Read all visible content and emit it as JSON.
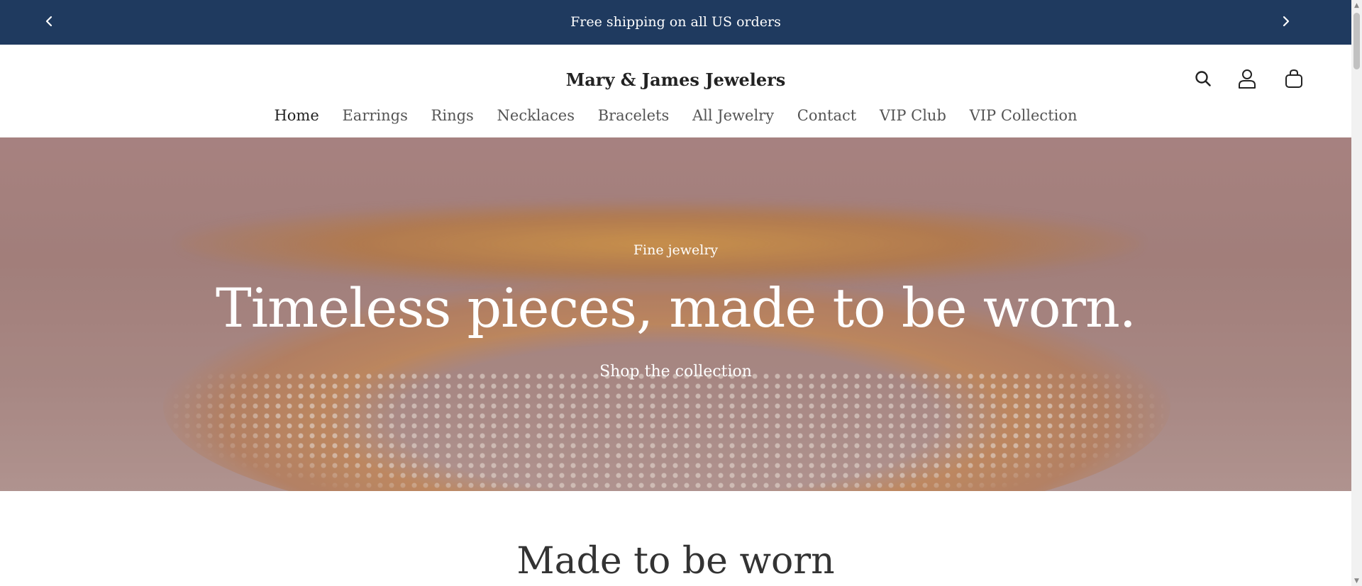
{
  "announcement": {
    "text": "Free shipping on all US orders",
    "prev_icon": "chevron-left-icon",
    "next_icon": "chevron-right-icon",
    "background": "#1f3a5f"
  },
  "header": {
    "brand": "Mary & James Jewelers",
    "icons": [
      "search-icon",
      "account-icon",
      "cart-icon"
    ]
  },
  "nav": {
    "items": [
      {
        "label": "Home"
      },
      {
        "label": "Earrings"
      },
      {
        "label": "Rings"
      },
      {
        "label": "Necklaces"
      },
      {
        "label": "Bracelets"
      },
      {
        "label": "All Jewelry"
      },
      {
        "label": "Contact"
      },
      {
        "label": "VIP Club"
      },
      {
        "label": "VIP Collection"
      }
    ],
    "active": "Home"
  },
  "hero": {
    "eyebrow": "Fine jewelry",
    "title": "Timeless pieces, made to be worn.",
    "cta": "Shop the collection"
  },
  "section": {
    "heading": "Made to be worn"
  }
}
